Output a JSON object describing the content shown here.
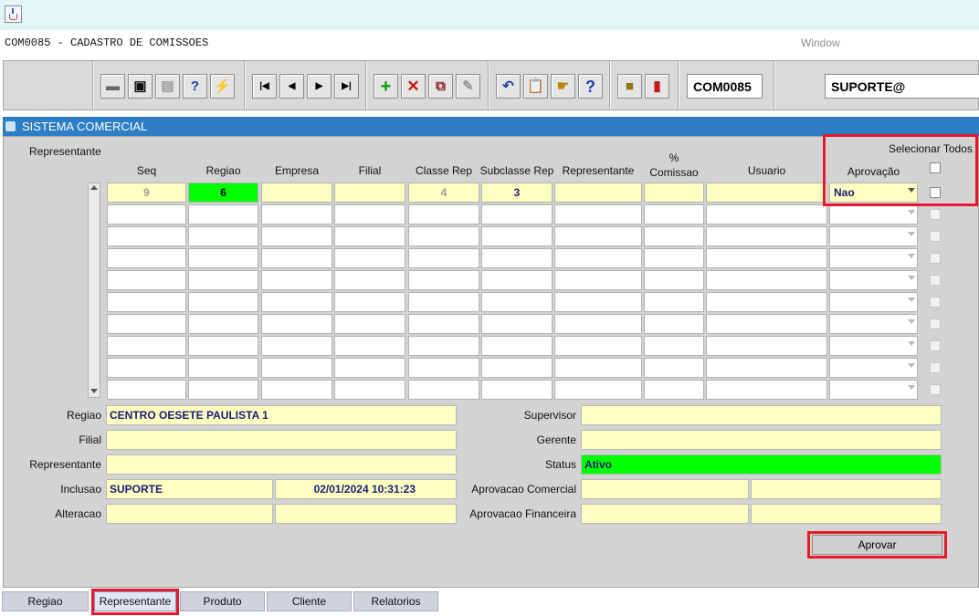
{
  "app": {
    "form_title": "COM0085 - CADASTRO DE COMISSOES",
    "menu_window": "Window",
    "window_title": "SISTEMA COMERCIAL"
  },
  "toolbar": {
    "form_code": "COM0085",
    "user_field": "SUPORTE@",
    "buttons": [
      "save-icon",
      "window-icon",
      "print-icon",
      "query-icon",
      "execute-icon",
      "first-record-icon",
      "previous-record-icon",
      "next-record-icon",
      "last-record-icon",
      "insert-record-icon",
      "delete-record-icon",
      "duplicate-record-icon",
      "clear-record-icon",
      "undo-icon",
      "clipboard-icon",
      "hand-icon",
      "help-icon",
      "menu-icon",
      "exit-icon"
    ]
  },
  "grid": {
    "section_label": "Representante",
    "select_all_label": "Selecionar Todos",
    "headers": {
      "seq": "Seq",
      "regiao": "Regiao",
      "empresa": "Empresa",
      "filial": "Filial",
      "classe_rep": "Classe Rep",
      "subclasse_rep": "Subclasse Rep",
      "representante": "Representante",
      "comissao_pct": "%",
      "comissao": "Comissao",
      "usuario": "Usuario",
      "aprovacao": "Aprovação"
    },
    "first_row": {
      "seq": "9",
      "regiao": "6",
      "empresa": "",
      "filial": "",
      "classe_rep": "4",
      "subclasse_rep": "3",
      "representante": "",
      "comissao": "",
      "usuario": "",
      "aprovacao": "Nao"
    },
    "empty_rows": 9
  },
  "detail": {
    "regiao_label": "Regiao",
    "regiao_value": "CENTRO OESETE PAULISTA 1",
    "filial_label": "Filial",
    "filial_value": "",
    "representante_label": "Representante",
    "representante_value": "",
    "inclusao_label": "Inclusao",
    "inclusao_user": "SUPORTE",
    "inclusao_date": "02/01/2024 10:31:23",
    "alteracao_label": "Alteracao",
    "supervisor_label": "Supervisor",
    "gerente_label": "Gerente",
    "status_label": "Status",
    "status_value": "Ativo",
    "aprov_comercial_label": "Aprovacao Comercial",
    "aprov_financeira_label": "Aprovacao Financeira",
    "aprovar_button": "Aprovar"
  },
  "tabs": [
    "Regiao",
    "Representante",
    "Produto",
    "Cliente",
    "Relatorios"
  ],
  "active_tab": "Representante",
  "colors": {
    "header_blue": "#2d7ec4",
    "field_yellow": "#ffffc2",
    "status_green": "#00ff00",
    "highlight_red": "#e8192c"
  }
}
